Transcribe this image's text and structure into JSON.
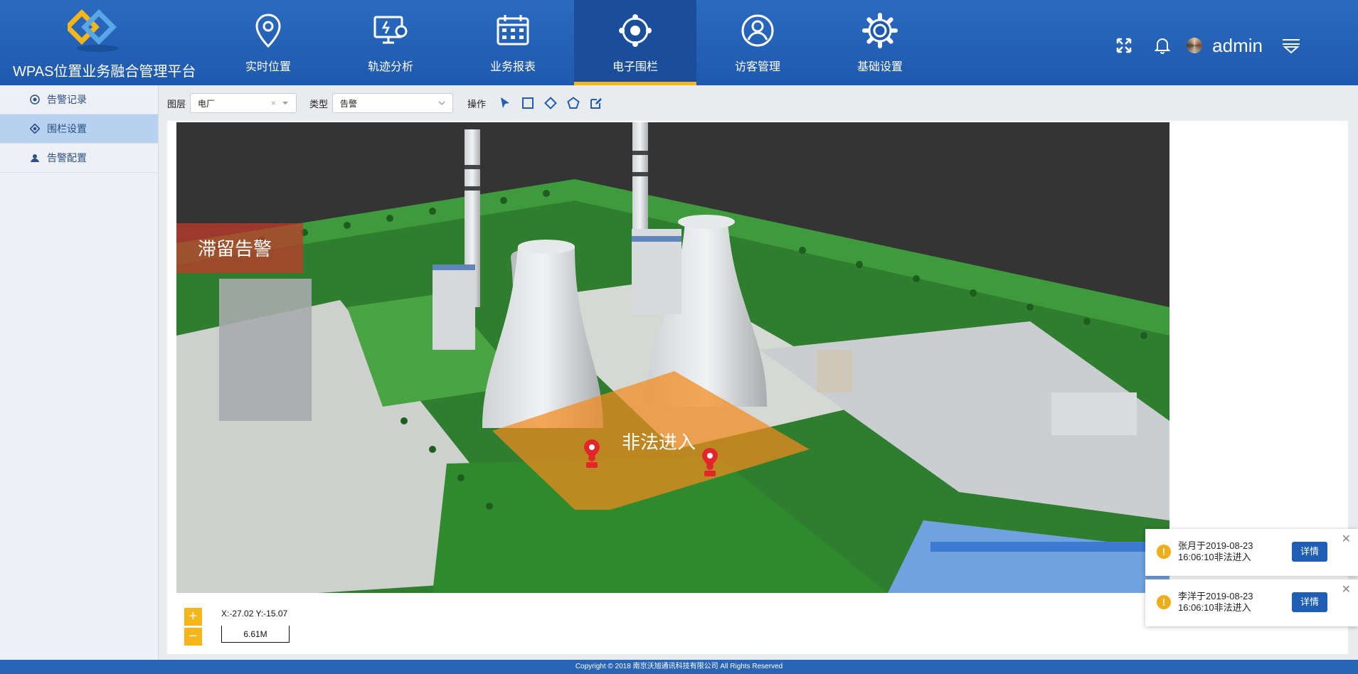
{
  "app": {
    "title": "WPAS位置业务融合管理平台"
  },
  "nav": [
    {
      "label": "实时位置",
      "icon": "map-pin-icon"
    },
    {
      "label": "轨迹分析",
      "icon": "monitor-track-icon"
    },
    {
      "label": "业务报表",
      "icon": "calendar-icon"
    },
    {
      "label": "电子围栏",
      "icon": "fence-target-icon",
      "active": true
    },
    {
      "label": "访客管理",
      "icon": "visitor-user-icon"
    },
    {
      "label": "基础设置",
      "icon": "gear-icon"
    }
  ],
  "header": {
    "username": "admin"
  },
  "sidebar": {
    "items": [
      {
        "label": "告警记录",
        "icon": "record-icon"
      },
      {
        "label": "围栏设置",
        "icon": "fence-icon",
        "active": true
      },
      {
        "label": "告警配置",
        "icon": "config-icon"
      }
    ]
  },
  "toolbar": {
    "layer_label": "图层",
    "layer_value": "电厂",
    "clear_glyph": "×",
    "type_label": "类型",
    "type_value": "告警",
    "ops_label": "操作"
  },
  "map": {
    "zone_stay_label": "滞留告警",
    "zone_illegal_label": "非法进入",
    "coords": "X:-27.02 Y:-15.07",
    "scale": "6.61M",
    "zoom_in": "+",
    "zoom_out": "−"
  },
  "notifications": [
    {
      "line1": "张月于2019-08-23",
      "line2": "16:06:10非法进入",
      "button": "详情",
      "close": "✕"
    },
    {
      "line1": "李洋于2019-08-23",
      "line2": "16:06:10非法进入",
      "button": "详情",
      "close": "✕"
    }
  ],
  "footer": {
    "text": "Copyright © 2018   南京沃旭通讯科技有限公司 All Rights Reserved"
  },
  "colors": {
    "header": "#2a6bbf",
    "active_nav": "#1a4e9a",
    "accent": "#f6b619",
    "button": "#1e5fb5"
  }
}
